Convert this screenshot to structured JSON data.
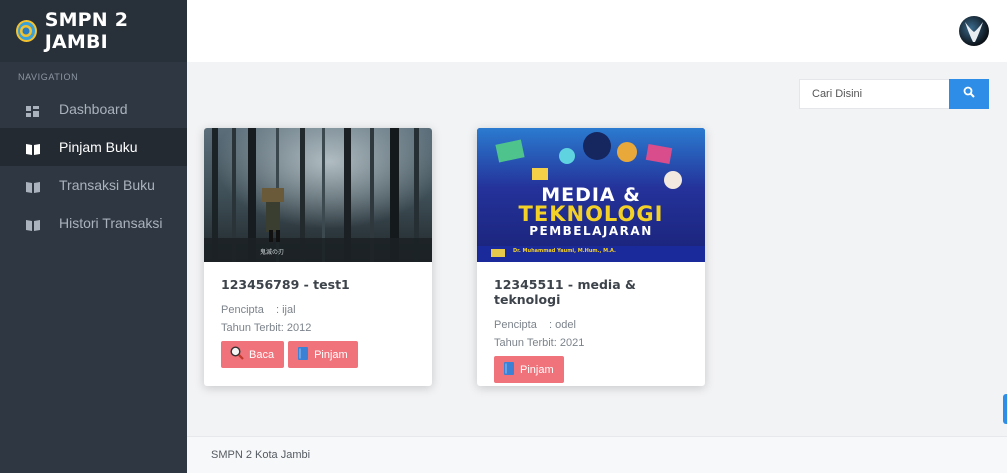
{
  "brand": {
    "title": "SMPN 2 JAMBI"
  },
  "sidebar": {
    "header": "NAVIGATION",
    "items": [
      {
        "label": "Dashboard",
        "icon": "dashboard-icon",
        "active": false
      },
      {
        "label": "Pinjam Buku",
        "icon": "book-icon",
        "active": true
      },
      {
        "label": "Transaksi Buku",
        "icon": "book-icon",
        "active": false
      },
      {
        "label": "Histori Transaksi",
        "icon": "book-icon",
        "active": false
      }
    ]
  },
  "search": {
    "placeholder": "Cari Disini",
    "icon": "search-icon"
  },
  "books": [
    {
      "title": "123456789 - test1",
      "pencipta_label": "Pencipta",
      "pencipta_value": ": ijal",
      "tahun_label": "Tahun Terbit",
      "tahun_value": ": 2012",
      "cover_caption": "鬼滅の刃",
      "buttons": {
        "baca": "Baca",
        "pinjam": "Pinjam"
      }
    },
    {
      "title": "12345511 - media & teknologi",
      "pencipta_label": "Pencipta",
      "pencipta_value": ": odel",
      "tahun_label": "Tahun Terbit",
      "tahun_value": ": 2021",
      "cover_line1": "MEDIA &",
      "cover_line2": "TEKNOLOGI",
      "cover_line3": "PEMBELAJARAN",
      "cover_author": "Dr. Muhammad Yaumi, M.Hum., M.A.",
      "buttons": {
        "pinjam": "Pinjam"
      }
    }
  ],
  "footer": {
    "text": "SMPN 2 Kota Jambi"
  },
  "colors": {
    "sidebar": "#2f3742",
    "accent": "#2e8de6",
    "button": "#f0727a"
  }
}
